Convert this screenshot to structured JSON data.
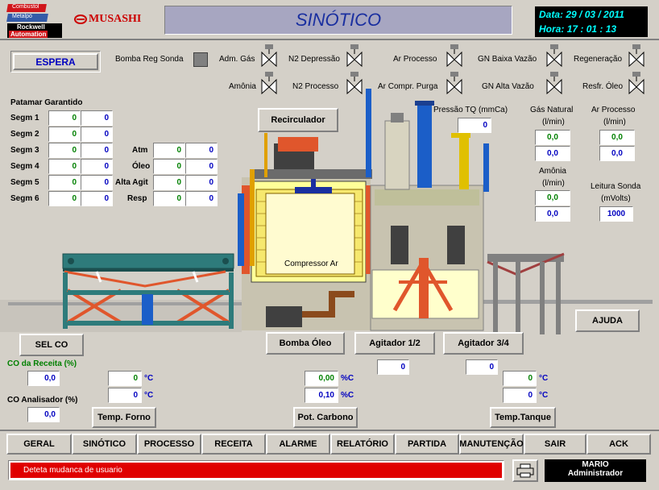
{
  "header": {
    "logo_combustol": "Combustol",
    "logo_metalpo": "Metalpó",
    "logo_rockwell": "Rockwell",
    "logo_automation": "Automation",
    "brand": "MUSASHI",
    "title": "SINÓTICO",
    "date_label": "Data:",
    "date_value": "29 / 03 /  2011",
    "time_label": "Hora:",
    "time_value": "17 : 01 : 13"
  },
  "status_button": "ESPERA",
  "bomba_reg_sonda": "Bomba Reg Sonda",
  "valves_row1": [
    "Adm. Gás",
    "N2 Depressão",
    "Ar Processo",
    "GN Baixa Vazão",
    "Regeneração"
  ],
  "valves_row2": [
    "Amônia",
    "N2 Processo",
    "Ar Compr. Purga",
    "GN Alta Vazão",
    "Resfr. Óleo"
  ],
  "patamar": {
    "title": "Patamar Garantido",
    "rows": [
      {
        "label": "Segm 1",
        "a": "0",
        "b": "0"
      },
      {
        "label": "Segm 2",
        "a": "0",
        "b": "0"
      },
      {
        "label": "Segm 3",
        "a": "0",
        "b": "0"
      },
      {
        "label": "Segm 4",
        "a": "0",
        "b": "0"
      },
      {
        "label": "Segm 5",
        "a": "0",
        "b": "0"
      },
      {
        "label": "Segm 6",
        "a": "0",
        "b": "0"
      }
    ]
  },
  "atm_table": [
    {
      "label": "Atm",
      "a": "0",
      "b": "0"
    },
    {
      "label": "Óleo",
      "a": "0",
      "b": "0"
    },
    {
      "label": "Alta Agit",
      "a": "0",
      "b": "0"
    },
    {
      "label": "Resp",
      "a": "0",
      "b": "0"
    }
  ],
  "recirculador": "Recirculador",
  "pressao": {
    "label": "Pressão TQ (mmCa)",
    "value": "0"
  },
  "gas_natural": {
    "label1": "Gás Natural",
    "label2": "(l/min)",
    "v1": "0,0",
    "v2": "0,0"
  },
  "ar_processo": {
    "label1": "Ar Processo",
    "label2": "(l/min)",
    "v1": "0,0",
    "v2": "0,0"
  },
  "amonia": {
    "label1": "Amônia",
    "label2": "(l/min)",
    "v1": "0,0",
    "v2": "0,0"
  },
  "leitura_sonda": {
    "label1": "Leitura Sonda",
    "label2": "(mVolts)",
    "value": "1000"
  },
  "compressor_label": "Compressor Ar",
  "ajuda": "AJUDA",
  "sel_co": "SEL CO",
  "bomba_oleo": "Bomba Óleo",
  "agitador12": {
    "label": "Agitador 1/2",
    "value": "0"
  },
  "agitador34": {
    "label": "Agitador 3/4",
    "value": "0"
  },
  "co_receita": {
    "label": "CO da Receita (%)",
    "value": "0,0"
  },
  "co_analisador": {
    "label": "CO Analisador (%)",
    "value": "0,0"
  },
  "temp_forno": {
    "label": "Temp. Forno",
    "v1": "0",
    "v2": "0",
    "unit": "°C"
  },
  "pot_carbono": {
    "label": "Pot. Carbono",
    "v1": "0,00",
    "v2": "0,10",
    "unit": "%C"
  },
  "temp_tanque": {
    "label": "Temp.Tanque",
    "v1": "0",
    "v2": "0",
    "unit": "°C"
  },
  "nav": [
    "GERAL",
    "SINÓTICO",
    "PROCESSO",
    "RECEITA",
    "ALARME",
    "RELATÓRIO",
    "PARTIDA",
    "MANUTENÇÃO",
    "SAIR",
    "ACK"
  ],
  "status_bar": {
    "message": "Deteta mudanca de usuario",
    "user": "MARIO",
    "role": "Administrador"
  },
  "colors": {
    "title_bg": "#a7a6c1",
    "title_text": "#1a2fa0",
    "clock_bg": "#000000",
    "clock_text": "#00ffff",
    "alarm_bar": "#e00000",
    "furnace_yellow": "#ffff99",
    "machinery_teal": "#2e7b7b",
    "orange": "#e0562c"
  }
}
